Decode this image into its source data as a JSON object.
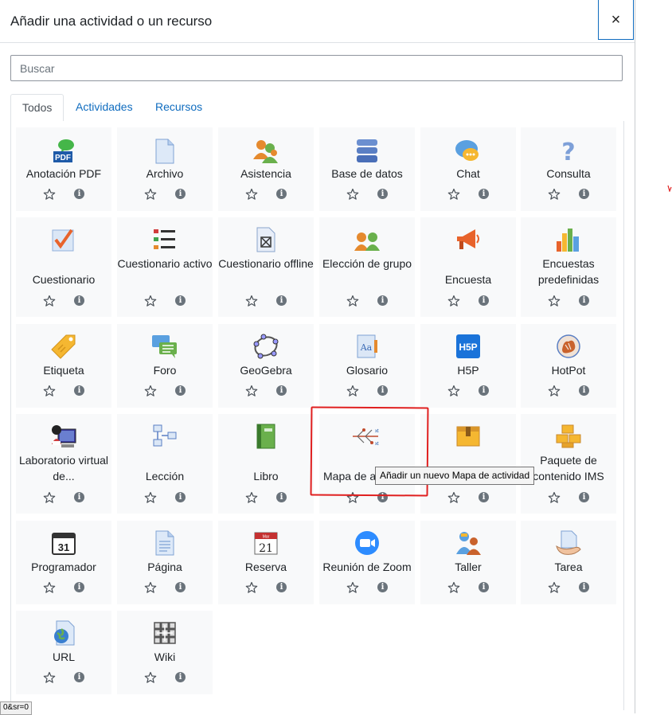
{
  "modal": {
    "title": "Añadir una actividad o un recurso",
    "close_label": "×",
    "search_placeholder": "Buscar",
    "tabs": [
      {
        "label": "Todos",
        "active": true
      },
      {
        "label": "Actividades",
        "active": false
      },
      {
        "label": "Recursos",
        "active": false
      }
    ]
  },
  "tiles": [
    {
      "label": "Anotación PDF",
      "icon": "pdf-annotation-icon"
    },
    {
      "label": "Archivo",
      "icon": "file-icon"
    },
    {
      "label": "Asistencia",
      "icon": "attendance-icon"
    },
    {
      "label": "Base de datos",
      "icon": "database-icon"
    },
    {
      "label": "Chat",
      "icon": "chat-icon"
    },
    {
      "label": "Consulta",
      "icon": "question-icon"
    },
    {
      "label": "Cuestionario",
      "icon": "quiz-icon"
    },
    {
      "label": "Cuestionario activo",
      "icon": "active-quiz-icon"
    },
    {
      "label": "Cuestionario offline",
      "icon": "offline-quiz-icon"
    },
    {
      "label": "Elección de grupo",
      "icon": "group-choice-icon"
    },
    {
      "label": "Encuesta",
      "icon": "megaphone-icon"
    },
    {
      "label": "Encuestas predefinidas",
      "icon": "bar-chart-icon"
    },
    {
      "label": "Etiqueta",
      "icon": "tag-icon"
    },
    {
      "label": "Foro",
      "icon": "forum-icon"
    },
    {
      "label": "GeoGebra",
      "icon": "geogebra-icon"
    },
    {
      "label": "Glosario",
      "icon": "glossary-icon"
    },
    {
      "label": "H5P",
      "icon": "h5p-icon"
    },
    {
      "label": "HotPot",
      "icon": "hotpot-icon"
    },
    {
      "label": "Laboratorio virtual de...",
      "icon": "virtual-lab-icon"
    },
    {
      "label": "Lección",
      "icon": "lesson-icon"
    },
    {
      "label": "Libro",
      "icon": "book-icon"
    },
    {
      "label": "Mapa de a",
      "icon": "activity-map-icon"
    },
    {
      "label": "",
      "icon": "box-icon"
    },
    {
      "label": "Paquete de contenido IMS",
      "icon": "ims-package-icon"
    },
    {
      "label": "Programador",
      "icon": "calendar-icon"
    },
    {
      "label": "Página",
      "icon": "page-icon"
    },
    {
      "label": "Reserva",
      "icon": "reservation-calendar-icon"
    },
    {
      "label": "Reunión de Zoom",
      "icon": "zoom-icon"
    },
    {
      "label": "Taller",
      "icon": "workshop-icon"
    },
    {
      "label": "Tarea",
      "icon": "assignment-icon"
    },
    {
      "label": "URL",
      "icon": "url-globe-icon"
    },
    {
      "label": "Wiki",
      "icon": "wiki-icon"
    }
  ],
  "tooltip": "Añadir un nuevo Mapa de actividad",
  "statusbar": "0&sr=0",
  "colors": {
    "accent": "#0f6cbf",
    "tile_bg": "#f8f9fa",
    "annotation": "#e02020"
  }
}
